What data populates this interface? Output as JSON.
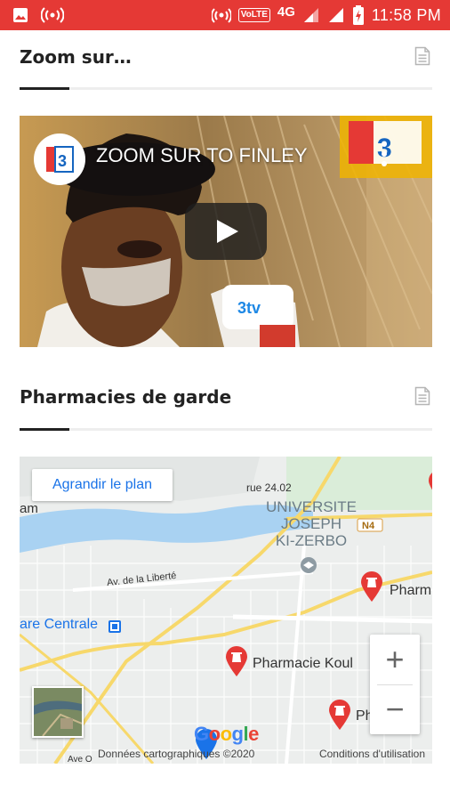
{
  "status_bar": {
    "volte": "VoLTE",
    "network": "4G",
    "time": "11:58 PM",
    "color": "#e53935"
  },
  "zoom_section": {
    "title": "Zoom sur…",
    "icon": "document-icon"
  },
  "video": {
    "title": "ZOOM SUR TO FINLEY",
    "play_icon": "play-icon"
  },
  "pharmacy_section": {
    "title": "Pharmacies de garde",
    "icon": "document-icon"
  },
  "map": {
    "enlarge_button": "Agrandir le plan",
    "labels": {
      "road": "rue 24.02",
      "am": "am",
      "university": [
        "UNIVERSITE",
        "JOSEPH",
        "KI-ZERBO"
      ],
      "n4": "N4",
      "avenue": "Av. de la Liberté",
      "pharm_right": "Pharm",
      "gare": "are Centrale",
      "pharmacie_koul": "Pharmacie Koul",
      "pharm_bottom": "Ph",
      "ave_o": "Ave O"
    },
    "google": [
      "G",
      "o",
      "o",
      "g",
      "l",
      "e"
    ],
    "google_colors": [
      "#4285f4",
      "#ea4335",
      "#fbbc05",
      "#4285f4",
      "#34a853",
      "#ea4335"
    ],
    "attribution": "Données cartographiques ©2020",
    "terms": "Conditions d'utilisation",
    "zoom_in": "+",
    "zoom_out": "−",
    "pin_color": "#e53935"
  }
}
